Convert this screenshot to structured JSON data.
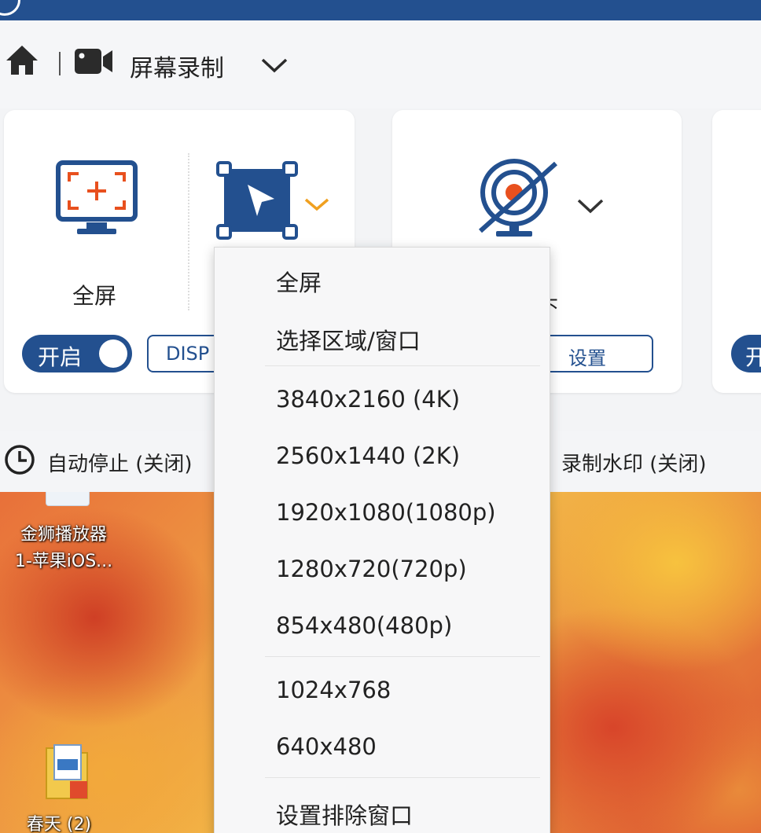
{
  "nav": {
    "title": "屏幕录制",
    "icons": [
      "home-icon",
      "video-camera-icon",
      "chevron-down-icon"
    ]
  },
  "cards": {
    "screen": {
      "fullscreen_label": "全屏",
      "toggle_label": "开启",
      "toggle_on": true,
      "display_button": "DISP"
    },
    "webcam": {
      "label_partial": "象头",
      "settings_button": "设置"
    },
    "third": {
      "toggle_partial": "开"
    }
  },
  "status": {
    "auto_stop": "自动停止 (关闭)",
    "watermark": "录制水印 (关闭)"
  },
  "desktop": {
    "icon1_line1": "金狮播放器",
    "icon1_line2": "1-苹果iOS...",
    "icon2_label": "春天 (2)"
  },
  "menu": {
    "items": [
      "全屏",
      "选择区域/窗口",
      "3840x2160 (4K)",
      "2560x1440 (2K)",
      "1920x1080(1080p)",
      "1280x720(720p)",
      "854x480(480p)",
      "1024x768",
      "640x480",
      "设置排除窗口"
    ]
  },
  "colors": {
    "brand_blue": "#23508f",
    "accent_orange": "#e8501e",
    "chevron_orange": "#f0a020"
  }
}
